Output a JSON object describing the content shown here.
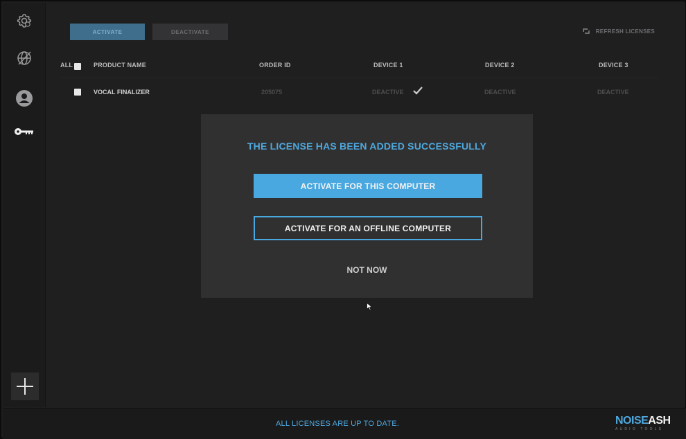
{
  "toolbar": {
    "activate_label": "ACTIVATE",
    "deactivate_label": "DEACTIVATE",
    "refresh_label": "REFRESH LICENSES"
  },
  "sidebar": {
    "items": [
      {
        "name": "settings",
        "icon": "gear-icon"
      },
      {
        "name": "sync-disabled",
        "icon": "globe-slash-icon"
      },
      {
        "name": "account",
        "icon": "user-icon"
      },
      {
        "name": "licenses",
        "icon": "key-icon"
      }
    ],
    "add_icon": "plus-icon"
  },
  "table": {
    "select_all_label": "ALL",
    "columns": [
      "PRODUCT NAME",
      "ORDER ID",
      "DEVICE 1",
      "DEVICE 2",
      "DEVICE 3"
    ],
    "rows": [
      {
        "product": "VOCAL FINALIZER",
        "order_id": "205075",
        "device1": "DEACTIVE",
        "device2": "DEACTIVE",
        "device3": "DEACTIVE"
      }
    ]
  },
  "modal": {
    "title": "THE LICENSE HAS BEEN ADDED SUCCESSFULLY",
    "primary_label": "ACTIVATE FOR THIS COMPUTER",
    "secondary_label": "ACTIVATE FOR AN OFFLINE COMPUTER",
    "dismiss_label": "NOT NOW"
  },
  "footer": {
    "status": "ALL LICENSES ARE UP TO DATE.",
    "logo_part1": "NOISE",
    "logo_part2": "ASH",
    "logo_tagline": "AUDIO TOOLS"
  },
  "colors": {
    "accent": "#4aa8e0",
    "background": "#1f1f20",
    "modal": "#303031"
  }
}
